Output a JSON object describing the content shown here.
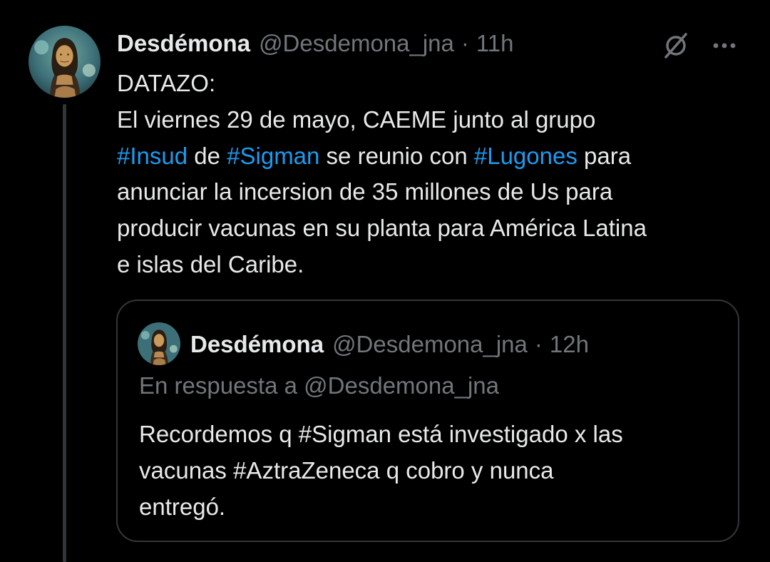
{
  "colors": {
    "background": "#000000",
    "text_primary": "#e7e9ea",
    "text_secondary": "#71767b",
    "hashtag": "#1d9bf0",
    "border": "#333639"
  },
  "tweet": {
    "author": {
      "name": "Desdémona",
      "handle": "@Desdemona_jna",
      "separator": "·",
      "time": "11h",
      "avatar_icon": "mona-lisa-avatar"
    },
    "actions": {
      "grok_icon": "grok-slash-circle-icon",
      "more_icon": "more-horizontal-icon"
    },
    "text": {
      "line1": "DATAZO:",
      "line2": "El viernes 29 de mayo, CAEME junto al grupo",
      "line3": {
        "tag1": "#Insud",
        "t1": " de ",
        "tag2": "#Sigman",
        "t2": " se reunio con ",
        "tag3": "#Lugones",
        "t3": " para"
      },
      "line4": "anunciar la incersion de 35 millones de Us para",
      "line5": "producir vacunas en su planta para América Latina",
      "line6": "e islas del Caribe."
    }
  },
  "quoted": {
    "author": {
      "name": "Desdémona",
      "handle": "@Desdemona_jna",
      "separator": "·",
      "time": "12h",
      "avatar_icon": "mona-lisa-avatar"
    },
    "reply_prefix": "En respuesta a ",
    "reply_handle": "@Desdemona_jna",
    "text": {
      "line1": "Recordemos q #Sigman  está investigado x las",
      "line2": "vacunas #AztraZeneca q cobro y nunca",
      "line3": "entregó."
    }
  }
}
